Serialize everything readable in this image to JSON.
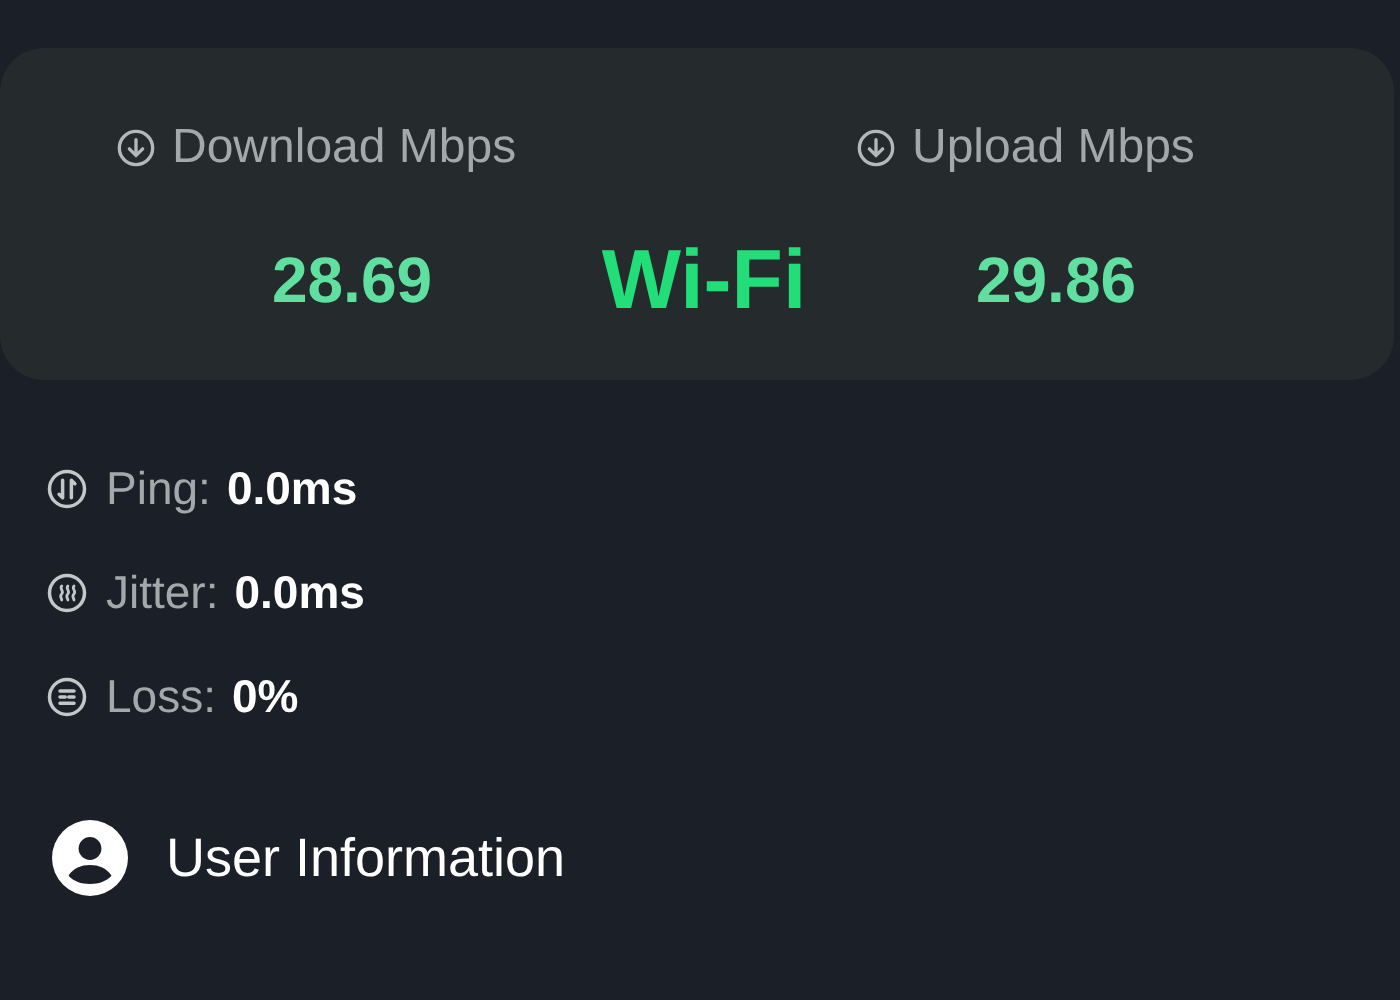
{
  "speed_card": {
    "download": {
      "label": "Download Mbps",
      "value": "28.69"
    },
    "upload": {
      "label": "Upload Mbps",
      "value": "29.86"
    },
    "connection": "Wi-Fi"
  },
  "stats": [
    {
      "kind": "ping",
      "label": "Ping:",
      "value": "0.0ms"
    },
    {
      "kind": "jitter",
      "label": "Jitter:",
      "value": "0.0ms"
    },
    {
      "kind": "loss",
      "label": "Loss:",
      "value": "0%"
    }
  ],
  "user_information": {
    "title": "User Information"
  }
}
